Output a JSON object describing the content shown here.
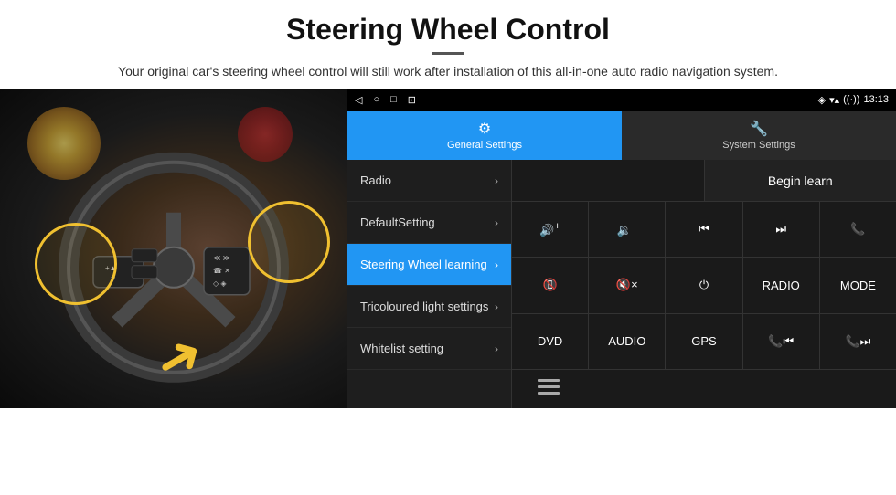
{
  "header": {
    "title": "Steering Wheel Control",
    "divider": true,
    "subtitle": "Your original car's steering wheel control will still work after installation of this all-in-one auto radio navigation system."
  },
  "statusBar": {
    "nav_back": "◁",
    "nav_home": "○",
    "nav_recent": "□",
    "nav_media": "⬜",
    "signal": "▾▾",
    "wifi": "▾",
    "time": "13:13"
  },
  "tabs": [
    {
      "id": "general",
      "label": "General Settings",
      "active": true
    },
    {
      "id": "system",
      "label": "System Settings",
      "active": false
    }
  ],
  "menu": [
    {
      "id": "radio",
      "label": "Radio",
      "active": false
    },
    {
      "id": "default",
      "label": "DefaultSetting",
      "active": false
    },
    {
      "id": "steering",
      "label": "Steering Wheel learning",
      "active": true
    },
    {
      "id": "tricoloured",
      "label": "Tricoloured light settings",
      "active": false
    },
    {
      "id": "whitelist",
      "label": "Whitelist setting",
      "active": false
    }
  ],
  "controls": {
    "begin_learn": "Begin learn",
    "rows": [
      [
        {
          "id": "vol-up",
          "label": "🔊+",
          "type": "icon"
        },
        {
          "id": "vol-down",
          "label": "🔉−",
          "type": "icon"
        },
        {
          "id": "prev-track",
          "label": "⏮",
          "type": "icon"
        },
        {
          "id": "next-track",
          "label": "⏭",
          "type": "icon"
        },
        {
          "id": "phone",
          "label": "📞",
          "type": "icon"
        }
      ],
      [
        {
          "id": "hang-up",
          "label": "📵",
          "type": "icon"
        },
        {
          "id": "mute",
          "label": "🔇×",
          "type": "icon"
        },
        {
          "id": "power",
          "label": "⏻",
          "type": "icon"
        },
        {
          "id": "radio-btn",
          "label": "RADIO",
          "type": "text"
        },
        {
          "id": "mode-btn",
          "label": "MODE",
          "type": "text"
        }
      ],
      [
        {
          "id": "dvd-btn",
          "label": "DVD",
          "type": "text"
        },
        {
          "id": "audio-btn",
          "label": "AUDIO",
          "type": "text"
        },
        {
          "id": "gps-btn",
          "label": "GPS",
          "type": "text"
        },
        {
          "id": "tel-prev",
          "label": "📞⏮",
          "type": "icon"
        },
        {
          "id": "tel-next",
          "label": "📞⏭",
          "type": "icon"
        }
      ],
      [
        {
          "id": "extra-btn",
          "label": "≡",
          "type": "icon"
        }
      ]
    ]
  }
}
